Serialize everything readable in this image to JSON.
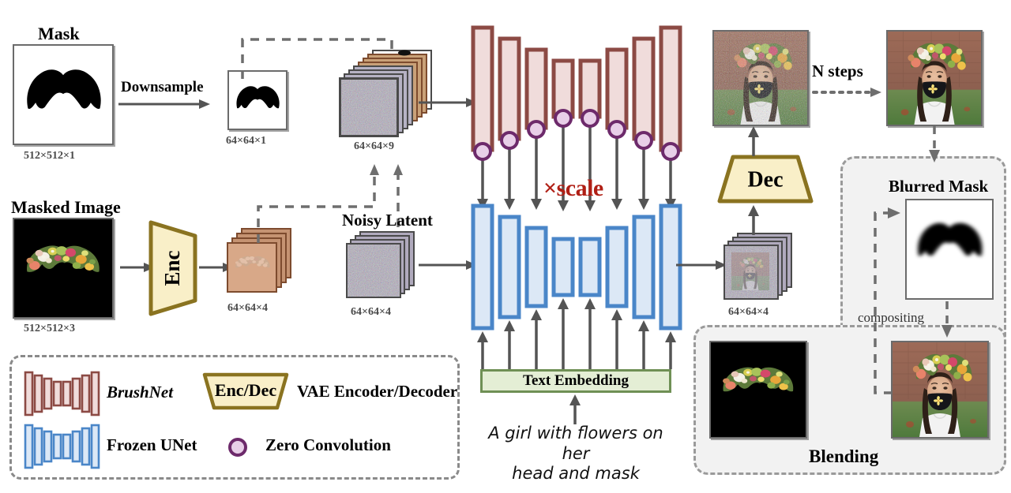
{
  "figure": {
    "title": "BrushNet inpainting pipeline diagram",
    "scale_label": "×scale",
    "accent_colors": {
      "brushnet_stroke": "#8c4a44",
      "brushnet_fill": "#f0dcdb",
      "unet_stroke": "#4a86c8",
      "unet_fill": "#dce8f6",
      "vae_stroke": "#8a7320",
      "vae_fill": "#f9efc8",
      "zeroconv_stroke": "#6d2a6b",
      "zeroconv_fill": "#e8cfe8",
      "text_embed_stroke": "#6f9055",
      "text_embed_fill": "#e4eed5",
      "scale_text": "#b01f15",
      "arrow": "#545454",
      "dash": "#6e6e6e",
      "group_fill": "#f2f2f2"
    }
  },
  "mask_branch": {
    "title": "Mask",
    "source_dim": "512×512×1",
    "downsample_label": "Downsample",
    "downsampled_dim": "64×64×1"
  },
  "masked_image_branch": {
    "title": "Masked Image",
    "source_dim": "512×512×3",
    "encoder_label": "Enc",
    "encoded_dim": "64×64×4"
  },
  "brushnet_input": {
    "dim": "64×64×9"
  },
  "noisy_latent": {
    "title": "Noisy Latent",
    "dim": "64×64×4"
  },
  "unet": {
    "brushnet_bar_heights": [
      158,
      131,
      105,
      77,
      77,
      105,
      131,
      158
    ],
    "unet_bar_heights": [
      158,
      131,
      105,
      77,
      77,
      105,
      131,
      158
    ],
    "zero_conv_count": 8
  },
  "text_conditioning": {
    "embedding_label": "Text Embedding",
    "prompt_line1": "A girl with flowers on her",
    "prompt_line2": "head and mask"
  },
  "decoder_branch": {
    "latent_dim": "64×64×4",
    "decoder_label": "Dec"
  },
  "diffusion": {
    "steps_label": "N steps"
  },
  "blending": {
    "group_label": "Blending",
    "blurred_mask_label": "Blurred Mask",
    "compositing_label": "compositing"
  },
  "legend": {
    "items": [
      {
        "key": "brushnet",
        "label": "BrushNet",
        "italic": true
      },
      {
        "key": "vae",
        "label": "VAE Encoder/Decoder",
        "swatch_text": "Enc/Dec",
        "italic": false
      },
      {
        "key": "frozen_unet",
        "label": "Frozen UNet",
        "italic": false
      },
      {
        "key": "zero_conv",
        "label": "Zero Convolution",
        "italic": false
      }
    ]
  }
}
